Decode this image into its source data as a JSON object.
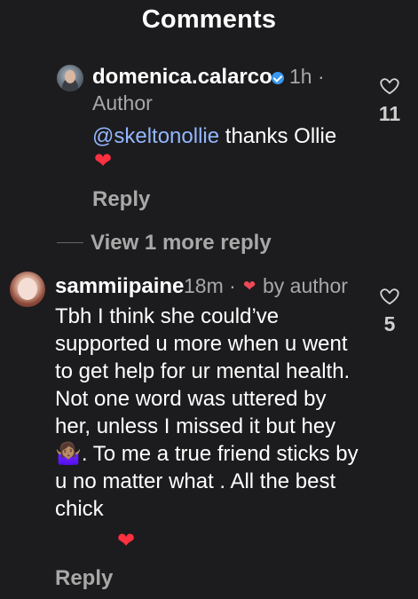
{
  "page": {
    "title": "Comments"
  },
  "reply_comment": {
    "username": "domenica.calarco",
    "time": "1h ·",
    "author_label": "Author",
    "mention": "@skeltonollie",
    "text": " thanks Ollie",
    "reply_label": "Reply",
    "like_count": "11"
  },
  "thread": {
    "view_more": "View 1 more reply"
  },
  "main_comment": {
    "username": "sammiipaine",
    "time": "18m ·",
    "by_author": "by author",
    "text": "Tbh I think she could’ve supported u more when u went to get help for ur mental health. Not one word was uttered by her, unless I missed it but hey 🤷🏽‍♀️. To me a true friend sticks by u no matter what . All the best chick",
    "reply_label": "Reply",
    "like_count": "5"
  },
  "icons": {
    "verified": "verified-badge-icon",
    "heart": "heart-outline-icon",
    "liked_heart": "red-heart-icon",
    "person_shrug": "person-shrugging-icon"
  },
  "colors": {
    "background": "#1c1c1e",
    "primary_text": "#ffffff",
    "secondary_text": "#a8a8a8",
    "mention": "#93b6ff",
    "verified": "#3897f0",
    "heart_red": "#ff3040"
  }
}
